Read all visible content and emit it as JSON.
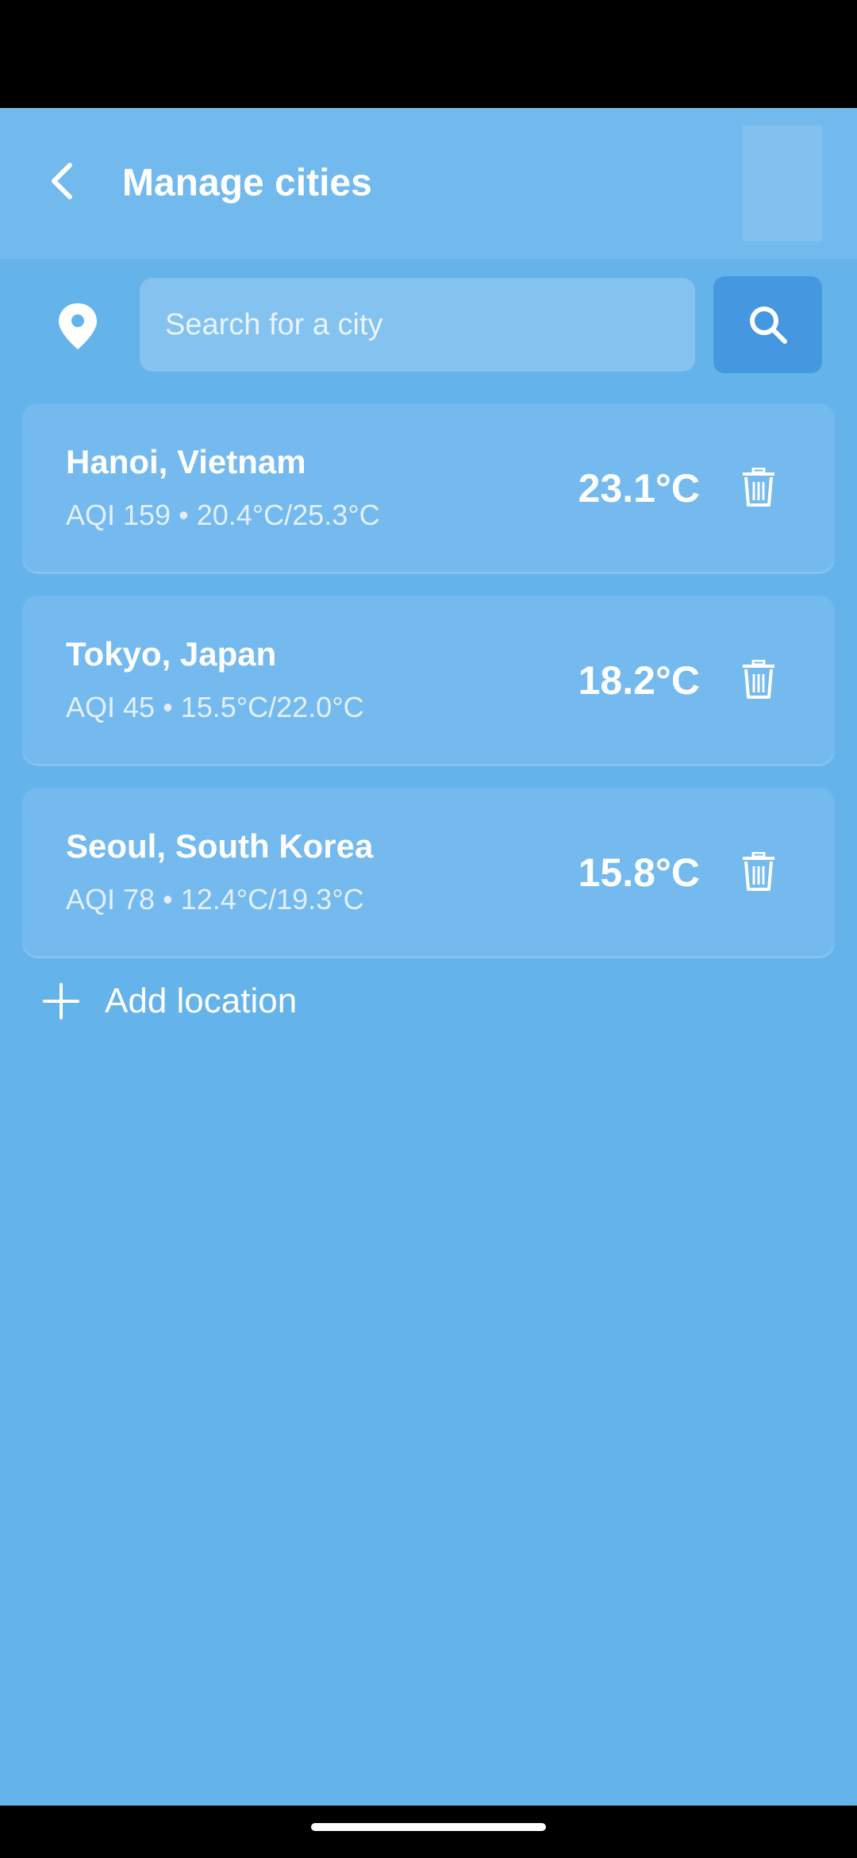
{
  "header": {
    "title": "Manage cities"
  },
  "search": {
    "placeholder": "Search for a city",
    "value": ""
  },
  "cities": [
    {
      "name": "Hanoi, Vietnam",
      "details": "AQI 159 • 20.4°C/25.3°C",
      "temp": "23.1°C"
    },
    {
      "name": "Tokyo, Japan",
      "details": "AQI 45 • 15.5°C/22.0°C",
      "temp": "18.2°C"
    },
    {
      "name": "Seoul, South Korea",
      "details": "AQI 78 • 12.4°C/19.3°C",
      "temp": "15.8°C"
    }
  ],
  "add_location": {
    "label": "Add location"
  },
  "icons": {
    "back": "chevron-left-icon",
    "location": "location-pin-icon",
    "search": "search-icon",
    "delete": "trash-icon",
    "add": "plus-icon"
  },
  "colors": {
    "background": "#65b3eb",
    "app_bar": "#72b9ed",
    "card": "#74baee",
    "search_field": "#84c2ef",
    "search_button": "#4597e0",
    "text": "#ffffff"
  }
}
